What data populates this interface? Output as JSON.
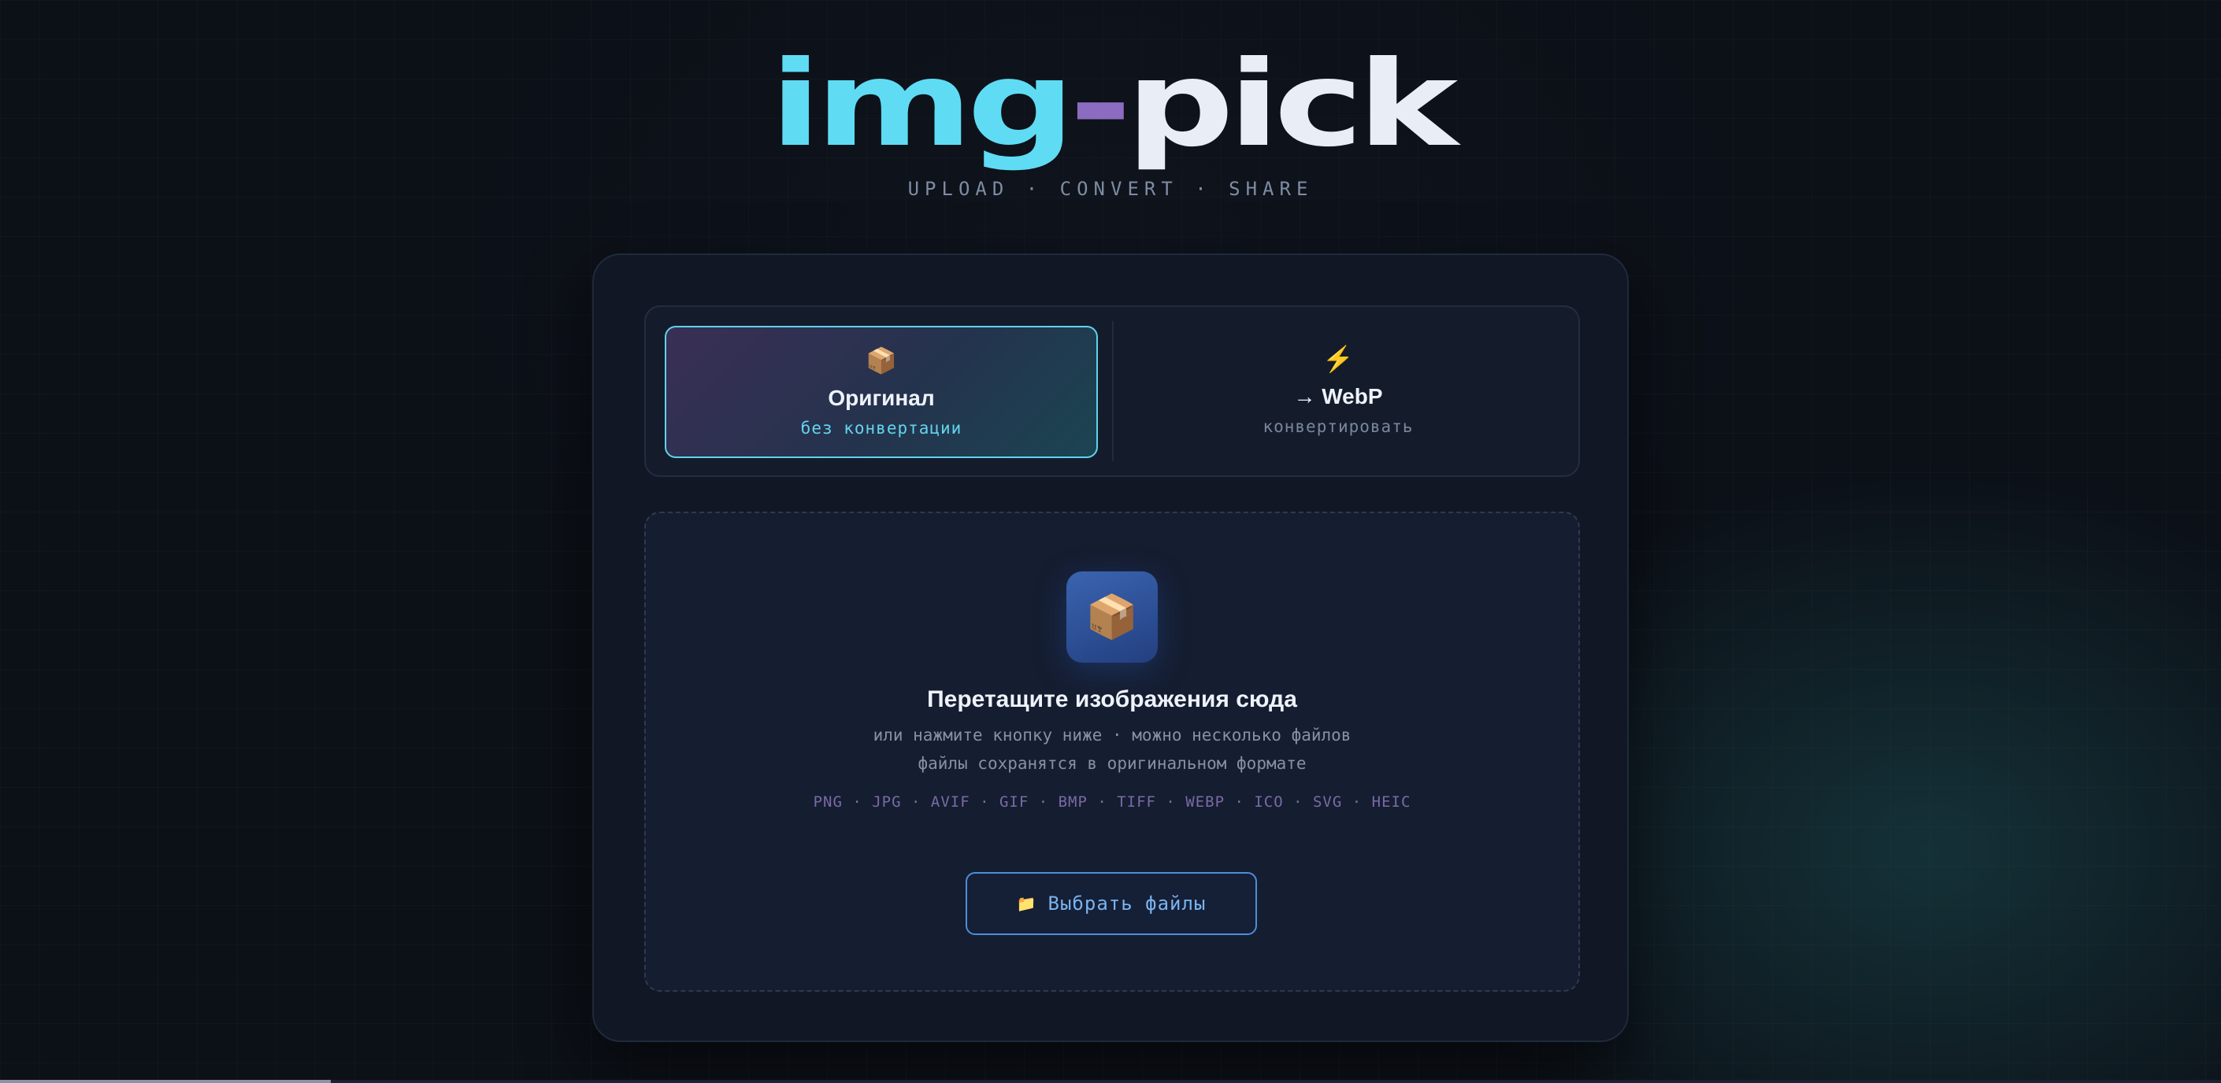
{
  "app": {
    "logo_part1": "img",
    "logo_dash": "-",
    "logo_part2": "pick",
    "tagline": "UPLOAD · CONVERT · SHARE"
  },
  "modes": {
    "original": {
      "icon": "package-icon",
      "glyph": "📦",
      "title": "Оригинал",
      "subtitle": "без конвертации",
      "selected": true
    },
    "webp": {
      "icon": "lightning-icon",
      "glyph": "⚡",
      "title": "→ WebP",
      "subtitle": "конвертировать",
      "selected": false
    }
  },
  "dropzone": {
    "icon": "package-icon",
    "glyph": "📦",
    "title": "Перетащите изображения сюда",
    "line1": "или нажмите кнопку ниже · можно несколько файлов",
    "line2": "файлы сохранятся в оригинальном формате",
    "formats": "PNG · JPG · AVIF · GIF · BMP · TIFF · WEBP · ICO · SVG · HEIC",
    "button_icon": "folder-icon",
    "button_glyph": "📁",
    "button_label": "Выбрать файлы"
  },
  "colors": {
    "accent_cyan": "#5fdcf3",
    "accent_purple": "#8b6cc0",
    "button_blue": "#4c8edb",
    "background": "#0c1017"
  }
}
